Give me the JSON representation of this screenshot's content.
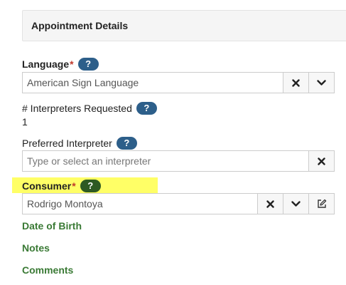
{
  "header": {
    "title": "Appointment Details"
  },
  "language": {
    "label": "Language",
    "required_mark": "*",
    "help": "?",
    "value": "American Sign Language"
  },
  "interpreters": {
    "label": "# Interpreters Requested",
    "help": "?",
    "value": "1"
  },
  "preferred": {
    "label": "Preferred Interpreter",
    "help": "?",
    "placeholder": "Type or select an interpreter"
  },
  "consumer": {
    "label": "Consumer",
    "required_mark": "*",
    "help": "?",
    "value": "Rodrigo Montoya"
  },
  "links": {
    "dob": "Date of Birth",
    "notes": "Notes",
    "comments": "Comments"
  },
  "icons": {
    "clear": "close-icon",
    "dropdown": "chevron-down-icon",
    "edit": "edit-icon"
  }
}
